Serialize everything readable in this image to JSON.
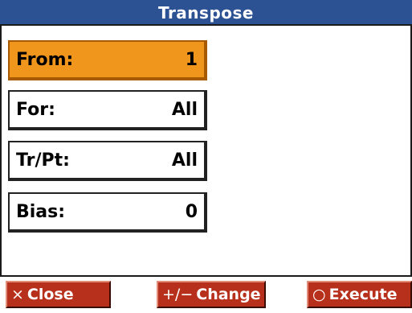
{
  "window": {
    "title": "Transpose"
  },
  "params": [
    {
      "label": "From:",
      "value": "1",
      "selected": true
    },
    {
      "label": "For:",
      "value": "All",
      "selected": false
    },
    {
      "label": "Tr/Pt:",
      "value": "All",
      "selected": false
    },
    {
      "label": "Bias:",
      "value": "0",
      "selected": false
    }
  ],
  "footer": {
    "close": {
      "icon": "×",
      "label": "Close"
    },
    "change": {
      "icon": "+/−",
      "label": "Change"
    },
    "execute": {
      "icon": "○",
      "label": "Execute"
    }
  },
  "colors": {
    "title_bg": "#2c5294",
    "selected_bg": "#f0961c",
    "button_bg": "#b7301b"
  }
}
